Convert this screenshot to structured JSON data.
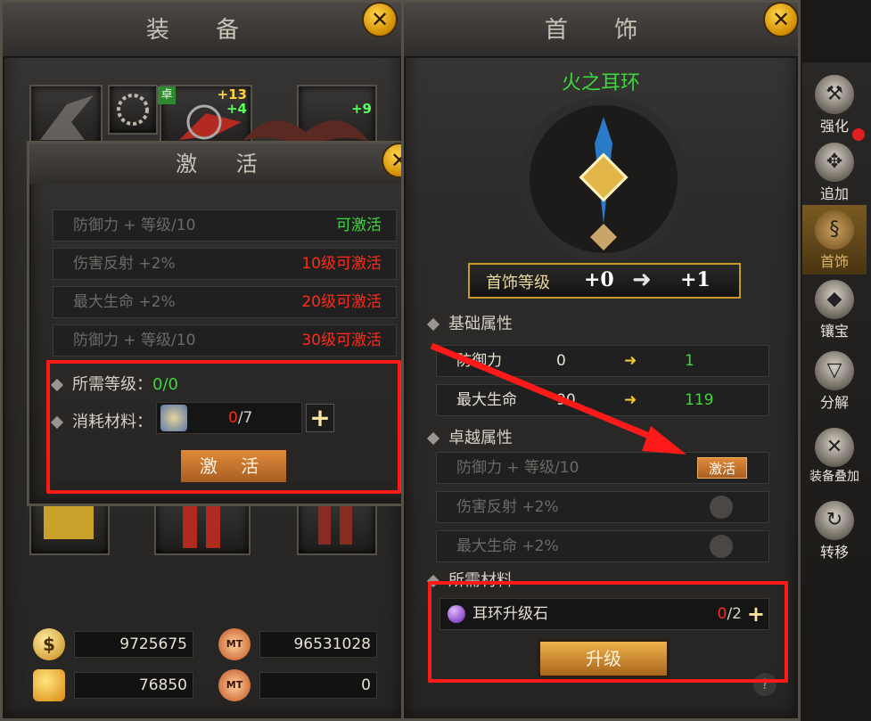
{
  "left_panel": {
    "title": "装 备",
    "close": "✕",
    "slots": {
      "top2_badge": "卓",
      "top2_plus1": "+13",
      "top2_plus2": "+4",
      "top3_plus": "+9"
    },
    "currency": {
      "gold": "9725675",
      "mt": "96531028",
      "diamond": "76850",
      "mt_bound": "0"
    }
  },
  "activate_dialog": {
    "title": "激 活",
    "close": "✕",
    "rows": [
      {
        "label": "防御力 + 等级/10",
        "status": "可激活"
      },
      {
        "label": "伤害反射 +2%",
        "status": "10级可激活"
      },
      {
        "label": "最大生命 +2%",
        "status": "20级可激活"
      },
      {
        "label": "防御力 + 等级/10",
        "status": "30级可激活"
      }
    ],
    "req_level_label": "所需等级：",
    "req_level_value": "0/0",
    "material_label": "消耗材料：",
    "material_have": "0",
    "material_need": "/7",
    "plus": "+",
    "activate_button": "激 活"
  },
  "right_panel": {
    "title": "首 饰",
    "close": "✕",
    "item_name": "火之耳环",
    "level_bar": {
      "label": "首饰等级",
      "from": "+0",
      "to": "+1"
    },
    "basic_section": "基础属性",
    "basic_stats": [
      {
        "name": "防御力",
        "from": "0",
        "to": "1"
      },
      {
        "name": "最大生命",
        "from": "90",
        "to": "119"
      }
    ],
    "excellent_section": "卓越属性",
    "excellent_stats": [
      {
        "name": "防御力 + 等级/10",
        "action": "激活"
      },
      {
        "name": "伤害反射 +2%"
      },
      {
        "name": "最大生命 +2%"
      }
    ],
    "material_section": "所需材料",
    "material_name": "耳环升级石",
    "material_have": "0",
    "material_need": "/2",
    "plus": "+",
    "upgrade_button": "升级",
    "help": "?"
  },
  "side_tabs": [
    "强化",
    "追加",
    "首饰",
    "镶宝",
    "分解",
    "装备叠加",
    "转移"
  ],
  "colors": {
    "green": "#3ed63e",
    "red": "#ff2a1a",
    "gold": "#e8a93a",
    "highlight_box": "#ff1a1a"
  }
}
